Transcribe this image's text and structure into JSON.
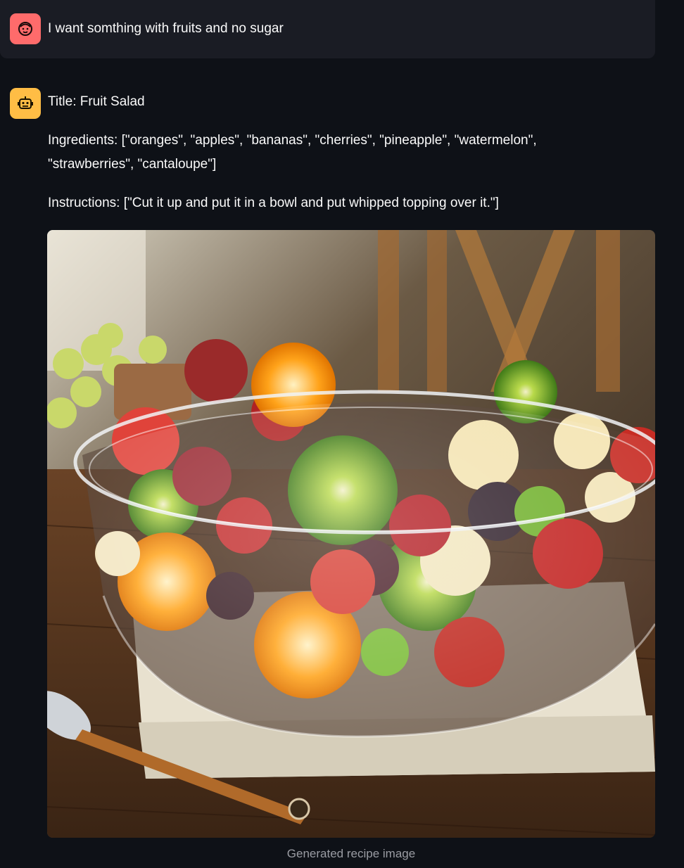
{
  "user_message": {
    "avatar_icon": "user-face-icon",
    "avatar_color": "#ff6b6b",
    "text": "I want somthing with fruits and no sugar"
  },
  "assistant_message": {
    "avatar_icon": "robot-icon",
    "avatar_color": "#ffbd45",
    "title_line": "Title: Fruit Salad",
    "ingredients_line": "Ingredients: [\"oranges\", \"apples\", \"bananas\", \"cherries\", \"pineapple\", \"watermelon\", \"strawberries\", \"cantaloupe\"]",
    "instructions_line": "Instructions: [\"Cut it up and put it in a bowl and put whipped topping over it.\"]",
    "image_caption": "Generated recipe image"
  },
  "theme": {
    "background": "#0e1117",
    "user_bubble": "#1a1c24",
    "text": "#fafafa",
    "caption": "#9a9ca3"
  }
}
